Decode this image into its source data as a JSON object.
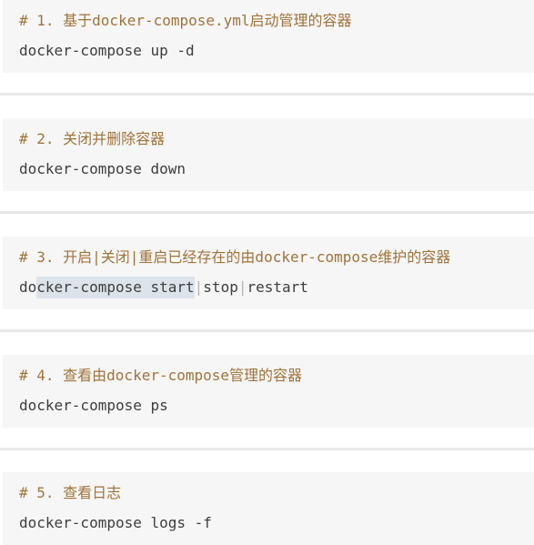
{
  "blocks": [
    {
      "comment": "# 1. 基于docker-compose.yml启动管理的容器",
      "command": "docker-compose up -d"
    },
    {
      "comment": "# 2. 关闭并删除容器",
      "command": "docker-compose down"
    },
    {
      "comment": "# 3. 开启|关闭|重启已经存在的由docker-compose维护的容器",
      "command_parts": {
        "pre": "do",
        "selected": "cker-compose start",
        "sep1": "|",
        "stop": "stop",
        "sep2": "|",
        "restart": "restart"
      }
    },
    {
      "comment": "# 4. 查看由docker-compose管理的容器",
      "command": "docker-compose ps"
    },
    {
      "comment": "# 5. 查看日志",
      "command": "docker-compose logs -f"
    }
  ],
  "colors": {
    "comment": "#a0733b",
    "command": "#3d3d3d",
    "block_bg": "#f6f6f6",
    "selection": "#dde3ea"
  }
}
